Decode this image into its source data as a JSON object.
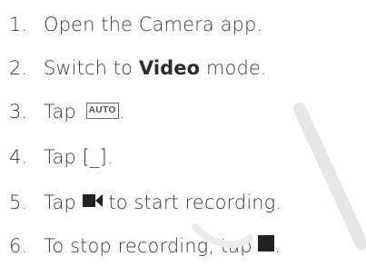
{
  "steps": [
    {
      "num": "1.",
      "text": "Open the Camera app."
    },
    {
      "num": "2.",
      "before": "Switch to ",
      "bold": "Video",
      "after": " mode."
    },
    {
      "num": "3.",
      "before": "Tap ",
      "icon_label": "AUTO",
      "after": "."
    },
    {
      "num": "4.",
      "text": "Tap [_]."
    },
    {
      "num": "5.",
      "before": "Tap ",
      "icon": "video-camera-icon",
      "after": " to start recording."
    },
    {
      "num": "6.",
      "before": "To stop recording, tap ",
      "icon": "stop-square-icon",
      "after": "."
    }
  ],
  "colors": {
    "text": "#3a3a3a",
    "icon": "#222222",
    "watermark": "#e6e6e6"
  }
}
